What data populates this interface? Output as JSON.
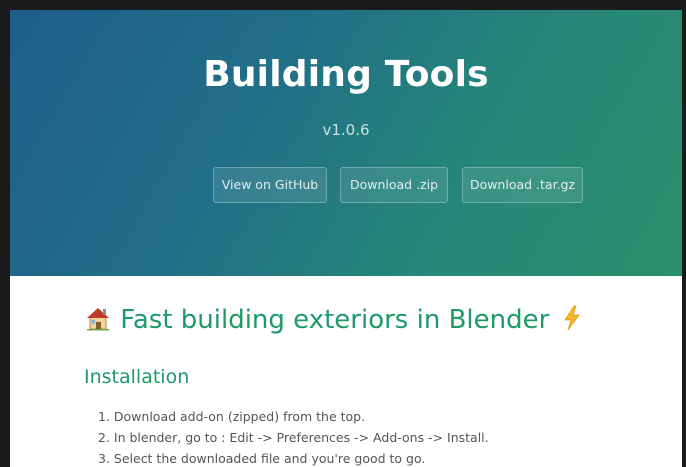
{
  "header": {
    "project_name": "Building Tools",
    "version": "v1.0.6",
    "buttons": {
      "github": "View on GitHub",
      "zip": "Download .zip",
      "tar": "Download .tar.gz"
    }
  },
  "main": {
    "heading_text": "Fast building exteriors in Blender",
    "heading_leading_icon": "house-icon",
    "heading_trailing_icon": "lightning-icon",
    "section_title": "Installation",
    "steps": [
      "1. Download add-on (zipped) from the top.",
      "2. In blender, go to : Edit -> Preferences -> Add-ons -> Install.",
      "3. Select the downloaded file and you're good to go."
    ]
  },
  "colors": {
    "hero_gradient_start": "#1f5f8b",
    "hero_gradient_end": "#2a8f6b",
    "heading_green": "#1e9968",
    "body_text": "#555555"
  }
}
